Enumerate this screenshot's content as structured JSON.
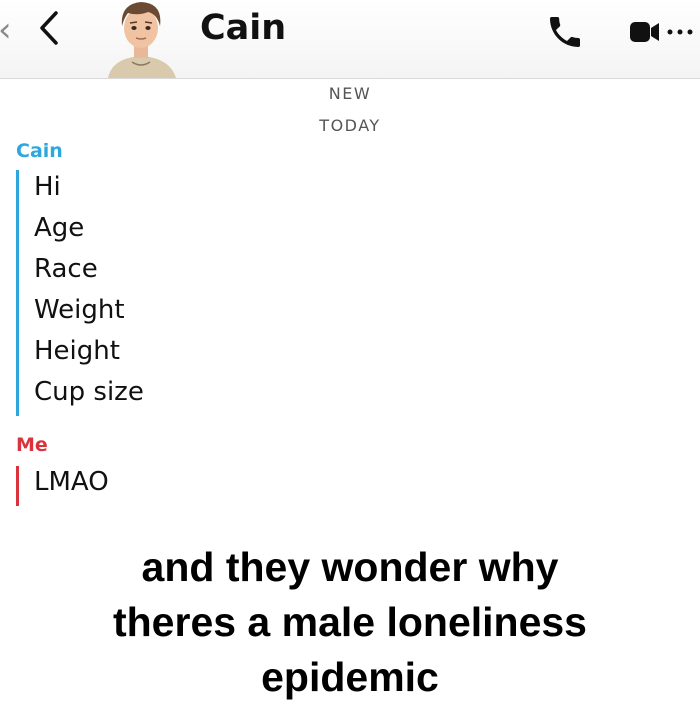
{
  "header": {
    "contact_name": "Cain",
    "back_icon": "chevron-left-icon",
    "call_icon": "phone-icon",
    "video_icon": "video-camera-icon"
  },
  "dividers": {
    "new": "NEW",
    "today": "TODAY"
  },
  "conversation": [
    {
      "sender": "Cain",
      "color": "#2ea8dc",
      "messages": [
        "Hi",
        "Age",
        "Race",
        "Weight",
        "Height",
        "Cup size"
      ]
    },
    {
      "sender": "Me",
      "color": "#d9343b",
      "messages": [
        "LMAO"
      ]
    }
  ],
  "caption": {
    "line1": "and they wonder why",
    "line2": "theres a male loneliness",
    "line3": "epidemic"
  }
}
